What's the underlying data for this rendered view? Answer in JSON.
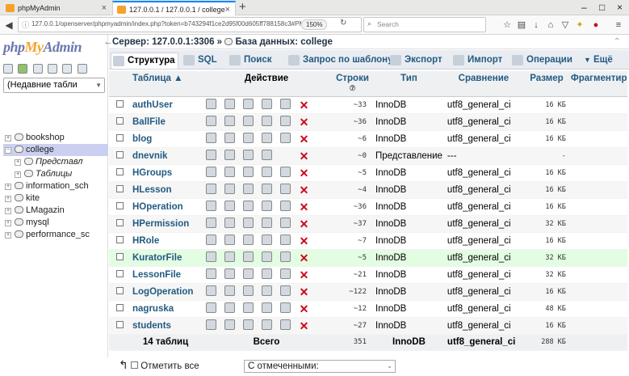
{
  "browser": {
    "tabs": [
      {
        "title": "phpMyAdmin"
      },
      {
        "title": "127.0.0.1 / 127.0.0.1 / college"
      }
    ],
    "new_tab": "+",
    "url": "127.0.0.1/openserver/phpmyadmin/index.php?token=b743294f1ce2d95f00d605ff788158c3#PMAURL",
    "zoom": "150%",
    "search_placeholder": "Search",
    "window_controls": [
      "–",
      "□",
      "×"
    ]
  },
  "sidebar": {
    "logo_a": "php",
    "logo_b": "My",
    "logo_c": "Admin",
    "recent_label": "(Недавние табли",
    "tree": [
      {
        "label": "bookshop",
        "expanded": "+"
      },
      {
        "label": "college",
        "expanded": "−",
        "selected": true
      },
      {
        "label": "Представл",
        "expanded": "+",
        "sub": true
      },
      {
        "label": "Таблицы",
        "expanded": "+",
        "sub": true
      },
      {
        "label": "information_sch",
        "expanded": "+"
      },
      {
        "label": "kite",
        "expanded": "+"
      },
      {
        "label": "LMagazin",
        "expanded": "+"
      },
      {
        "label": "mysql",
        "expanded": "+"
      },
      {
        "label": "performance_sc",
        "expanded": "+"
      }
    ]
  },
  "breadcrumb": {
    "server": "Сервер: 127.0.0.1:3306",
    "sep": "»",
    "db": "База данных: college"
  },
  "tabs": [
    {
      "label": "Структура",
      "active": true
    },
    {
      "label": "SQL"
    },
    {
      "label": "Поиск"
    },
    {
      "label": "Запрос по шаблону"
    },
    {
      "label": "Экспорт"
    },
    {
      "label": "Импорт"
    },
    {
      "label": "Операции"
    },
    {
      "label": "Ещё"
    }
  ],
  "table": {
    "headers": {
      "table": "Таблица ▲",
      "action": "Действие",
      "rows": "Строки",
      "type": "Тип",
      "collation": "Сравнение",
      "size": "Размер",
      "overhead": "Фрагментир"
    },
    "rows": [
      {
        "name": "authUser",
        "rows": "~33",
        "type": "InnoDB",
        "collation": "utf8_general_ci",
        "size": "16 КБ"
      },
      {
        "name": "BallFile",
        "rows": "~36",
        "type": "InnoDB",
        "collation": "utf8_general_ci",
        "size": "16 КБ"
      },
      {
        "name": "blog",
        "rows": "~6",
        "type": "InnoDB",
        "collation": "utf8_general_ci",
        "size": "16 КБ"
      },
      {
        "name": "dnevnik",
        "rows": "~0",
        "type": "Представление",
        "collation": "---",
        "size": "-"
      },
      {
        "name": "HGroups",
        "rows": "~5",
        "type": "InnoDB",
        "collation": "utf8_general_ci",
        "size": "16 КБ"
      },
      {
        "name": "HLesson",
        "rows": "~4",
        "type": "InnoDB",
        "collation": "utf8_general_ci",
        "size": "16 КБ"
      },
      {
        "name": "HOperation",
        "rows": "~36",
        "type": "InnoDB",
        "collation": "utf8_general_ci",
        "size": "16 КБ"
      },
      {
        "name": "HPermission",
        "rows": "~37",
        "type": "InnoDB",
        "collation": "utf8_general_ci",
        "size": "32 КБ"
      },
      {
        "name": "HRole",
        "rows": "~7",
        "type": "InnoDB",
        "collation": "utf8_general_ci",
        "size": "16 КБ"
      },
      {
        "name": "KuratorFile",
        "rows": "~5",
        "type": "InnoDB",
        "collation": "utf8_general_ci",
        "size": "32 КБ"
      },
      {
        "name": "LessonFile",
        "rows": "~21",
        "type": "InnoDB",
        "collation": "utf8_general_ci",
        "size": "32 КБ"
      },
      {
        "name": "LogOperation",
        "rows": "~122",
        "type": "InnoDB",
        "collation": "utf8_general_ci",
        "size": "16 КБ"
      },
      {
        "name": "nagruska",
        "rows": "~12",
        "type": "InnoDB",
        "collation": "utf8_general_ci",
        "size": "48 КБ"
      },
      {
        "name": "students",
        "rows": "~27",
        "type": "InnoDB",
        "collation": "utf8_general_ci",
        "size": "16 КБ"
      }
    ],
    "footer": {
      "count": "14 таблиц",
      "total_label": "Всего",
      "rows": "351",
      "type": "InnoDB",
      "collation": "utf8_general_ci",
      "size": "288 КБ"
    }
  },
  "bottom": {
    "mark_all": "Отметить все",
    "with_selected": "С отмеченными:"
  },
  "colors": {
    "accent": "#235a81",
    "highlight_row": "#e3fde3",
    "delete": "#d0021b"
  }
}
